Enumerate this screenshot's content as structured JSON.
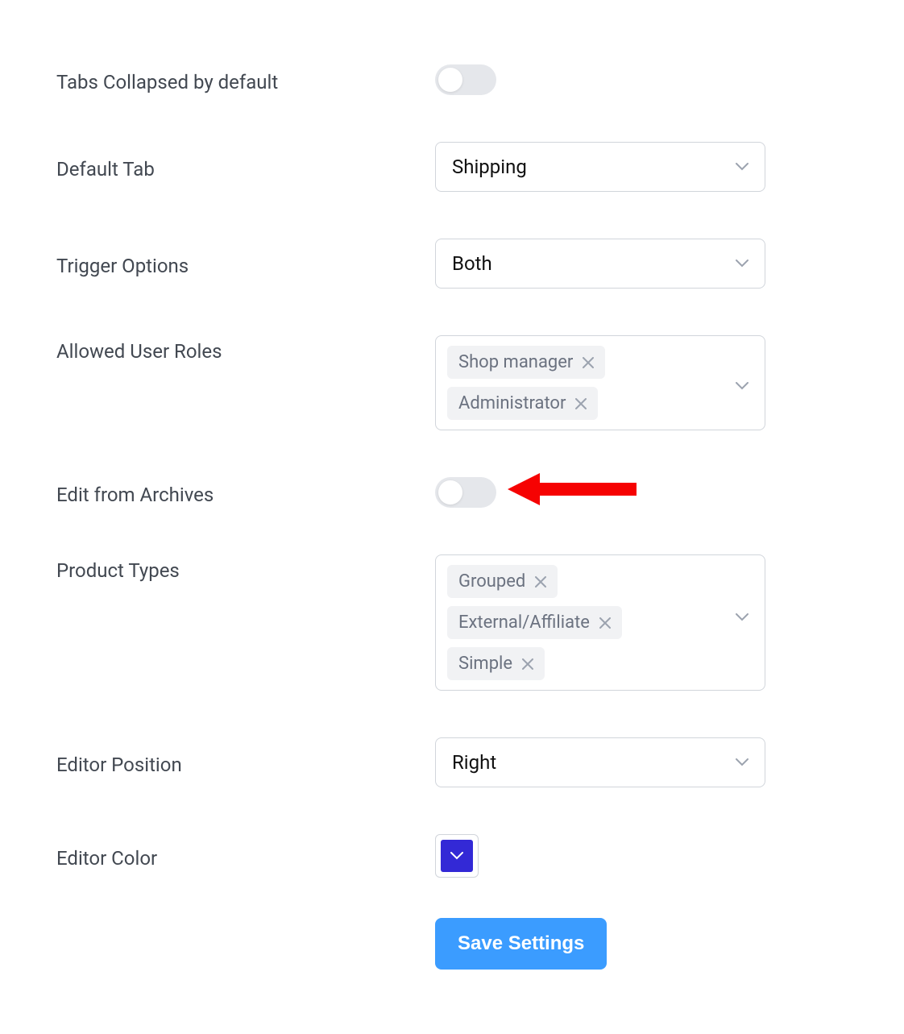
{
  "settings": {
    "tabs_collapsed": {
      "label": "Tabs Collapsed by default",
      "value": false
    },
    "default_tab": {
      "label": "Default Tab",
      "value": "Shipping"
    },
    "trigger_options": {
      "label": "Trigger Options",
      "value": "Both"
    },
    "allowed_user_roles": {
      "label": "Allowed User Roles",
      "values": [
        "Shop manager",
        "Administrator"
      ]
    },
    "edit_from_archives": {
      "label": "Edit from Archives",
      "value": false
    },
    "product_types": {
      "label": "Product Types",
      "values": [
        "Grouped",
        "External/Affiliate",
        "Simple"
      ]
    },
    "editor_position": {
      "label": "Editor Position",
      "value": "Right"
    },
    "editor_color": {
      "label": "Editor Color",
      "value": "#3329d6"
    },
    "save_button": "Save Settings"
  }
}
